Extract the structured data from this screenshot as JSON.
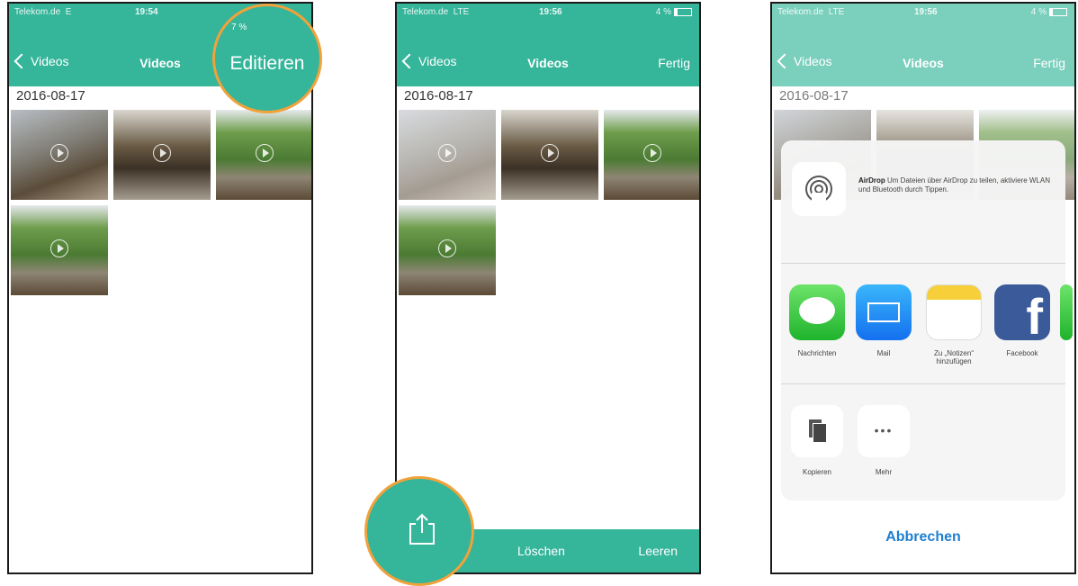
{
  "status": {
    "carrier": "Telekom.de",
    "network1": "E",
    "time1": "19:54",
    "battery1": "7 %",
    "network2": "LTE",
    "time2": "19:56",
    "battery2": "4 %"
  },
  "nav": {
    "back": "Videos",
    "title": "Videos",
    "edit": "Editieren",
    "done": "Fertig"
  },
  "date": "2016-08-17",
  "bottom": {
    "delete": "Löschen",
    "clear": "Leeren"
  },
  "share": {
    "airdrop_title": "AirDrop",
    "airdrop_text": "Um Dateien über AirDrop zu teilen, aktiviere WLAN und Bluetooth durch Tippen.",
    "apps": [
      "Nachrichten",
      "Mail",
      "Zu „Notizen“ hinzufügen",
      "Facebook"
    ],
    "copy": "Kopieren",
    "more": "Mehr",
    "more_glyph": "•••",
    "cancel": "Abbrechen"
  },
  "accent": "#35b59a",
  "highlight": "#f0a23b",
  "icons": [
    "chevron-left-icon",
    "play-icon",
    "share-icon",
    "airdrop-icon",
    "messages-icon",
    "mail-icon",
    "notes-icon",
    "facebook-icon",
    "copy-icon",
    "more-icon"
  ]
}
